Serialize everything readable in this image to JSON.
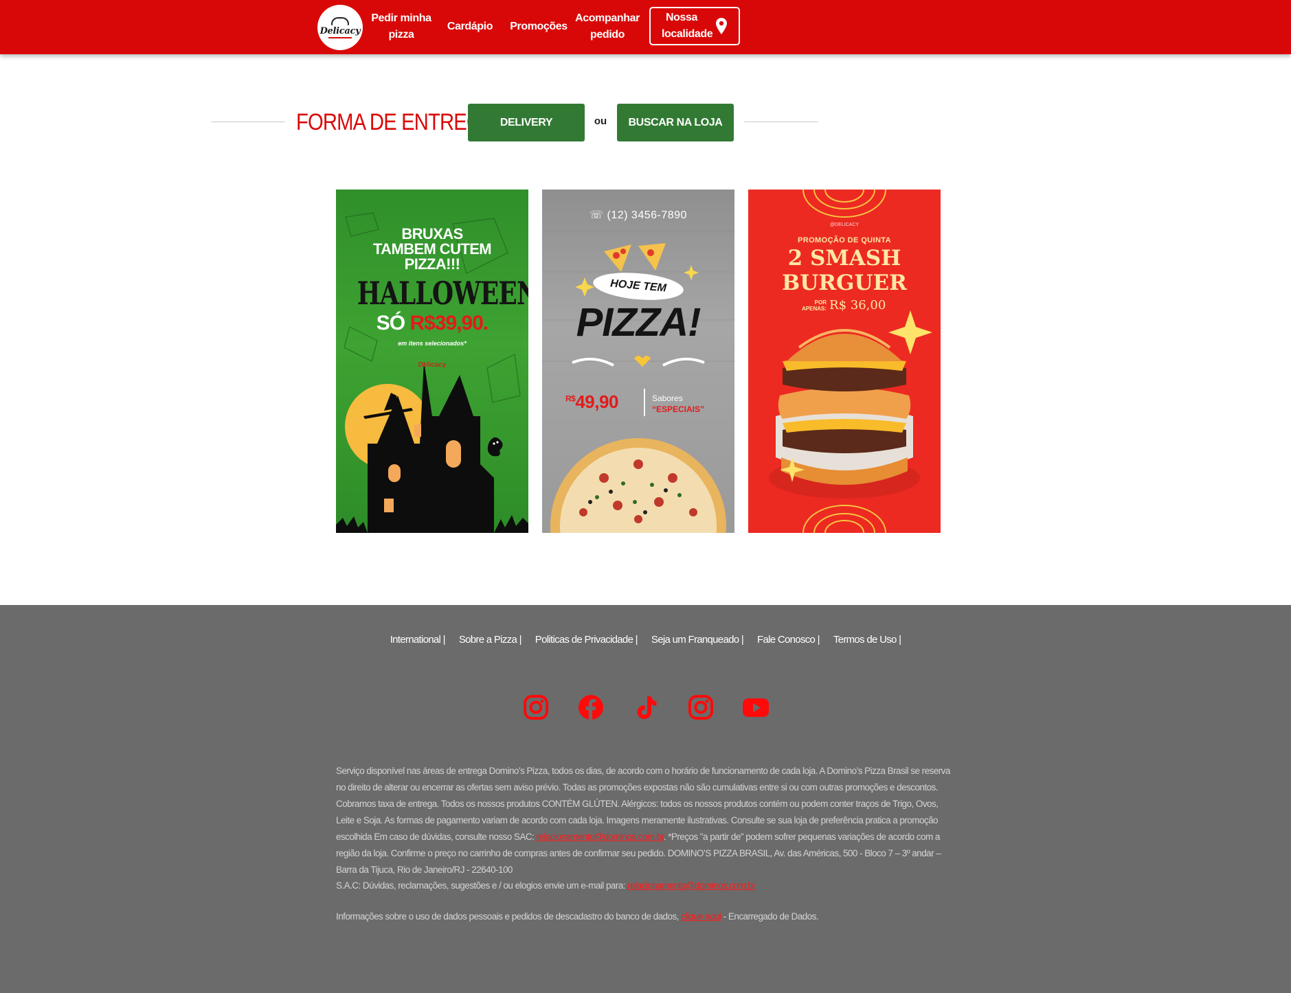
{
  "brand": {
    "name": "Delicacy",
    "accent": "#d90808",
    "green": "#327a34"
  },
  "nav": {
    "pedir_line1": "Pedir minha",
    "pedir_line2": "pizza",
    "cardapio": "Cardápio",
    "promocoes": "Promoções",
    "acompanhar_line1": "Acompanhar",
    "acompanhar_line2": "pedido",
    "localidade_line1": "Nossa",
    "localidade_line2": "localidade",
    "localidade_icon": "map-pin-icon"
  },
  "delivery": {
    "title": "FORMA DE ENTREGA",
    "delivery_label": "DELIVERY",
    "or_label": "ou",
    "store_label": "BUSCAR NA LOJA"
  },
  "cards": {
    "halloween": {
      "line1": "BRUXAS",
      "line2": "TAMBEM CUTEM",
      "line3": "PIZZA!!!",
      "headline": "HALLOWEEN",
      "so": "SÓ",
      "price": "R$39,90.",
      "subtitle": "em itens selecionados*",
      "brand": "Delicacy"
    },
    "pizza": {
      "phone": "(12) 3456-7890",
      "tag": "HOJE TEM",
      "headline": "PIZZA!",
      "currency": "R$",
      "price": "49,90",
      "sabores": "Sabores",
      "especiais": "“ESPECIAIS”"
    },
    "burger": {
      "handle": "@DELICACY",
      "promo": "PROMOÇÃO DE QUINTA",
      "title_line1": "2 SMASH",
      "title_line2": "BURGUER",
      "por": "POR",
      "apenas": "APENAS:",
      "price": "R$ 36,00"
    }
  },
  "footer": {
    "links": [
      "International |",
      "Sobre a Pizza |",
      "Politicas de Privacidade |",
      "Seja um Franqueado |",
      "Fale Conosco |",
      "Termos de Uso |"
    ],
    "socials": [
      "instagram-icon",
      "facebook-icon",
      "tiktok-icon",
      "instagram-icon",
      "youtube-icon"
    ],
    "legal_part1": "Serviço disponível nas áreas de entrega Domino’s Pizza, todos os dias, de acordo com o horário de funcionamento de cada loja. A Domino’s Pizza Brasil se reserva no direito de alterar ou encerrar as ofertas sem aviso prévio. Todas as promoções expostas não são cumulativas entre si ou com outras promoções e descontos. Cobramos taxa de entrega. Todos os nossos produtos CONTÉM GLÚTEN. Alérgicos: todos os nossos produtos contém ou podem conter traços de Trigo, Ovos, Leite e Soja. As formas de pagamento variam de acordo com cada loja. Imagens meramente ilustrativas. Consulte se sua loja de preferência pratica a promoção escolhida Em caso de dúvidas, consulte nosso SAC: ",
    "legal_email": "relacionamento@dominos.com.br",
    "legal_part2": ". *Preços \"a partir de\" podem sofrer pequenas variações de acordo com a região da loja. Confirme o preço no carrinho de compras antes de confirmar seu pedido. DOMINO’S PIZZA BRASIL, Av. das Américas, 500 - Bloco 7 – 3º andar – Barra da Tijuca, Rio de Janeiro/RJ - 22640-100",
    "sac_text": "S.A.C: Dúvidas, reclamações, sugestões e / ou elogios envie um e-mail para: ",
    "sac_email": "relacionamento@dominos.com.br",
    "dados_text1": "Informações sobre o uso de dados pessoais e pedidos de descadastro do banco de dados, ",
    "dados_link": "clique aqui",
    "dados_text2": " - Encarregado de Dados."
  }
}
